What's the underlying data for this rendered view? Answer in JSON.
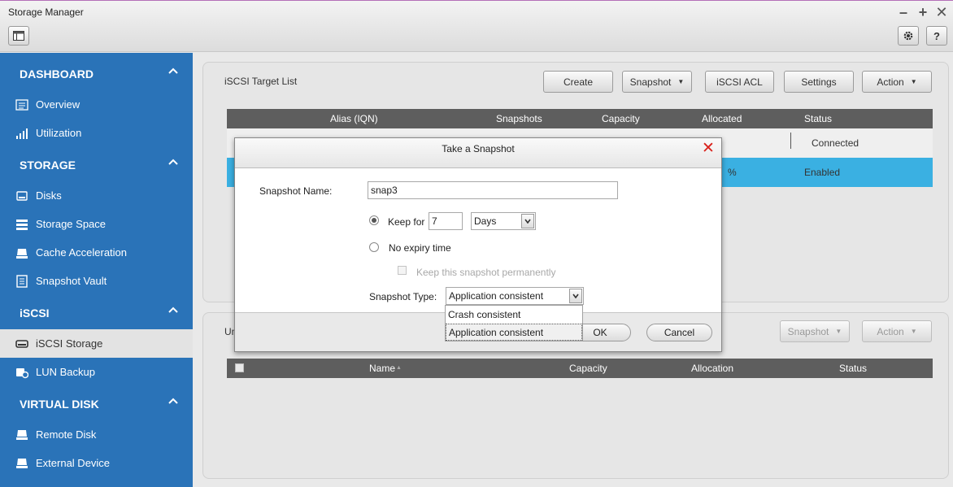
{
  "window": {
    "title": "Storage Manager"
  },
  "sidebar": {
    "sections": [
      {
        "title": "DASHBOARD",
        "items": [
          {
            "label": "Overview"
          },
          {
            "label": "Utilization"
          }
        ]
      },
      {
        "title": "STORAGE",
        "items": [
          {
            "label": "Disks"
          },
          {
            "label": "Storage Space"
          },
          {
            "label": "Cache Acceleration"
          },
          {
            "label": "Snapshot Vault"
          }
        ]
      },
      {
        "title": "iSCSI",
        "items": [
          {
            "label": "iSCSI Storage"
          },
          {
            "label": "LUN Backup"
          }
        ]
      },
      {
        "title": "VIRTUAL DISK",
        "items": [
          {
            "label": "Remote Disk"
          },
          {
            "label": "External Device"
          }
        ]
      }
    ],
    "active": "iSCSI Storage"
  },
  "target_panel": {
    "title": "iSCSI Target List",
    "buttons": {
      "create": "Create",
      "snapshot": "Snapshot",
      "acl": "iSCSI ACL",
      "settings": "Settings",
      "action": "Action"
    },
    "columns": [
      "Alias (IQN)",
      "Snapshots",
      "Capacity",
      "Allocated",
      "Status"
    ],
    "rows": [
      {
        "status": "Connected"
      },
      {
        "allocated": "%",
        "status": "Enabled"
      }
    ]
  },
  "lun_panel": {
    "title_fragment": "Un",
    "buttons": {
      "snapshot": "Snapshot",
      "action": "Action"
    },
    "columns": [
      "Name",
      "Capacity",
      "Allocation",
      "Status"
    ],
    "sort_indicator": "▲"
  },
  "dialog": {
    "title": "Take a Snapshot",
    "name_label": "Snapshot Name:",
    "name_value": "snap3",
    "keep_for_label": "Keep for",
    "keep_for_value": "7",
    "keep_unit": "Days",
    "no_expiry_label": "No expiry time",
    "keep_perm_label": "Keep this snapshot permanently",
    "type_label": "Snapshot Type:",
    "type_value": "Application consistent",
    "type_options": [
      "Crash consistent",
      "Application consistent"
    ],
    "ok": "OK",
    "cancel": "Cancel"
  },
  "colors": {
    "sidebar": "#2a73b8",
    "selected_row": "#3ab0e2",
    "table_header": "#5e5e5e",
    "close": "#d9221c"
  }
}
